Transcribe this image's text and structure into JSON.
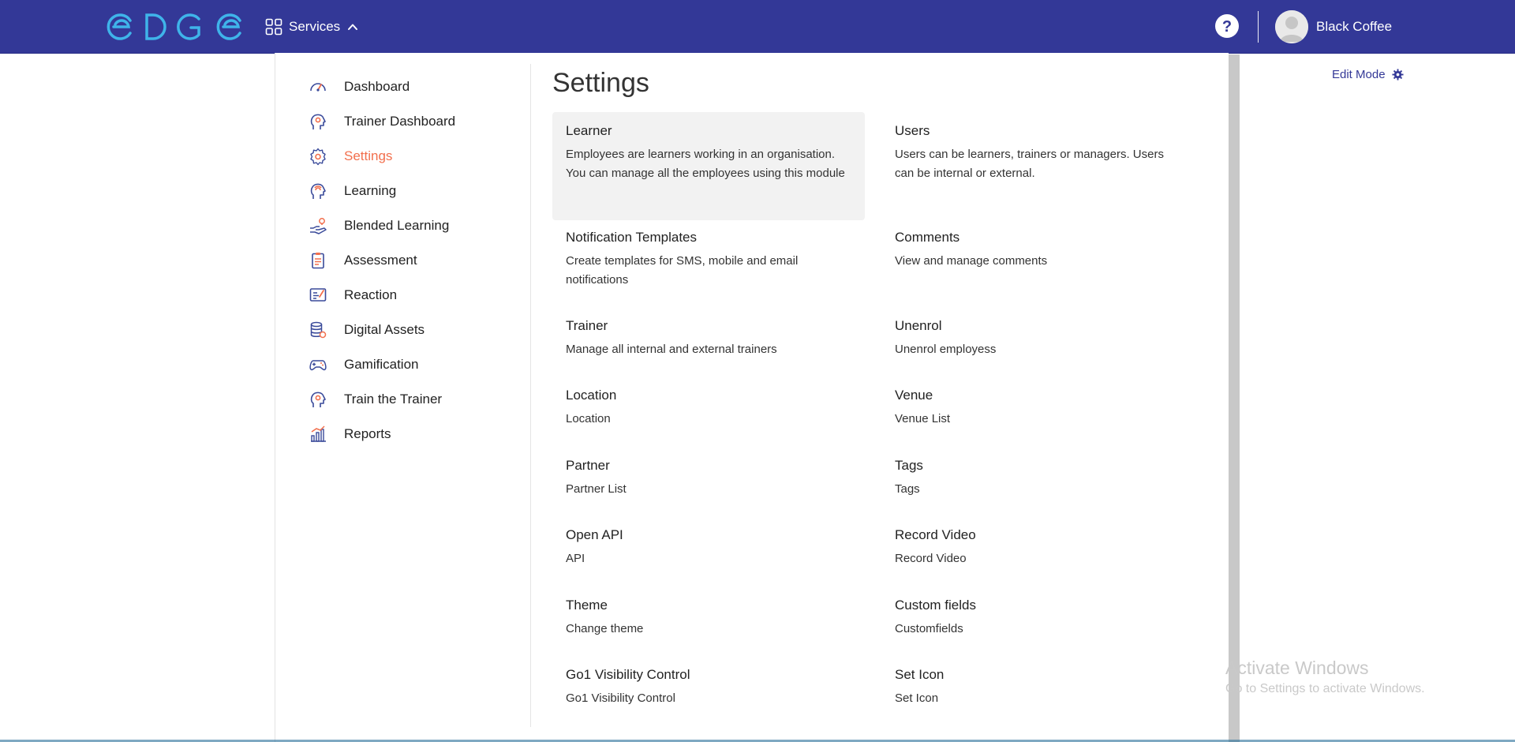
{
  "header": {
    "logo_text": "EDGE",
    "services_label": "Services",
    "user_name": "Black Coffee",
    "brand_color": "#333897"
  },
  "edit_mode": {
    "label": "Edit Mode"
  },
  "menu": {
    "active_color": "#f26f4d",
    "items": [
      {
        "label": "Dashboard",
        "icon": "speedometer-icon"
      },
      {
        "label": "Trainer Dashboard",
        "icon": "head-gear-icon"
      },
      {
        "label": "Settings",
        "icon": "gear-icon",
        "active": true
      },
      {
        "label": "Learning",
        "icon": "head-idea-icon"
      },
      {
        "label": "Blended Learning",
        "icon": "hand-bulb-icon"
      },
      {
        "label": "Assessment",
        "icon": "clipboard-icon"
      },
      {
        "label": "Reaction",
        "icon": "feedback-icon"
      },
      {
        "label": "Digital Assets",
        "icon": "database-icon"
      },
      {
        "label": "Gamification",
        "icon": "gamepad-icon"
      },
      {
        "label": "Train the Trainer",
        "icon": "head-gear-icon"
      },
      {
        "label": "Reports",
        "icon": "bar-chart-icon"
      }
    ]
  },
  "settings": {
    "title": "Settings",
    "cards": [
      {
        "title": "Learner",
        "desc": "Employees are learners working in an organisation. You can manage all the employees using this module"
      },
      {
        "title": "Users",
        "desc": "Users can be learners, trainers or managers. Users can be internal or external."
      },
      {
        "title": "Notification Templates",
        "desc": "Create templates for SMS, mobile and email notifications"
      },
      {
        "title": "Comments",
        "desc": "View and manage comments"
      },
      {
        "title": "Trainer",
        "desc": "Manage all internal and external trainers"
      },
      {
        "title": "Unenrol",
        "desc": "Unenrol employess"
      },
      {
        "title": "Location",
        "desc": "Location"
      },
      {
        "title": "Venue",
        "desc": "Venue List"
      },
      {
        "title": "Partner",
        "desc": "Partner List"
      },
      {
        "title": "Tags",
        "desc": "Tags"
      },
      {
        "title": "Open API",
        "desc": "API"
      },
      {
        "title": "Record Video",
        "desc": "Record Video"
      },
      {
        "title": "Theme",
        "desc": "Change theme"
      },
      {
        "title": "Custom fields",
        "desc": "Customfields"
      },
      {
        "title": "Go1 Visibility Control",
        "desc": "Go1 Visibility Control"
      },
      {
        "title": "Set Icon",
        "desc": "Set Icon"
      }
    ]
  },
  "watermark": {
    "line1": "Activate Windows",
    "line2": "Go to Settings to activate Windows."
  }
}
